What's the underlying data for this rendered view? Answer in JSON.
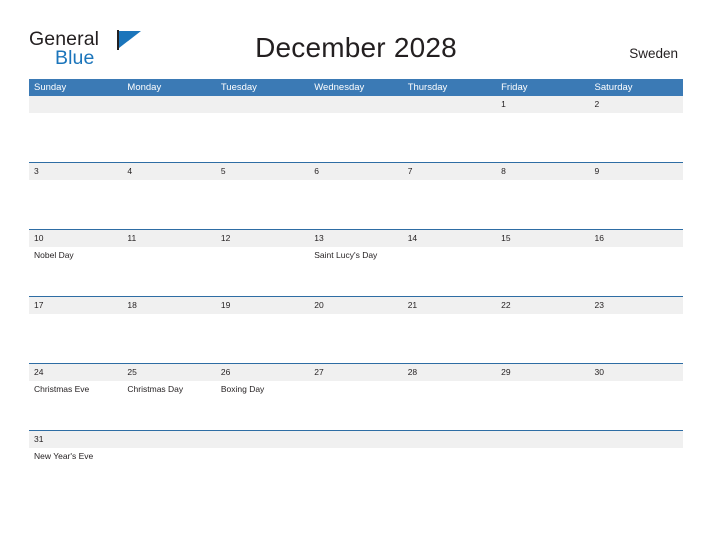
{
  "brand": {
    "name_part1": "General",
    "name_part2": "Blue",
    "flag_icon": "blue-flag-icon",
    "color_dark": "#231f20",
    "color_blue": "#1b75bb"
  },
  "header": {
    "title": "December 2028",
    "country": "Sweden"
  },
  "theme": {
    "header_blue": "#3b7ab5",
    "row_divider_blue": "#2e6da4",
    "date_band_gray": "#f0f0f0",
    "text_dark": "#231f20",
    "cell_white": "#ffffff"
  },
  "weekdays": [
    "Sunday",
    "Monday",
    "Tuesday",
    "Wednesday",
    "Thursday",
    "Friday",
    "Saturday"
  ],
  "weeks": [
    [
      {
        "date": "",
        "event": ""
      },
      {
        "date": "",
        "event": ""
      },
      {
        "date": "",
        "event": ""
      },
      {
        "date": "",
        "event": ""
      },
      {
        "date": "",
        "event": ""
      },
      {
        "date": "1",
        "event": ""
      },
      {
        "date": "2",
        "event": ""
      }
    ],
    [
      {
        "date": "3",
        "event": ""
      },
      {
        "date": "4",
        "event": ""
      },
      {
        "date": "5",
        "event": ""
      },
      {
        "date": "6",
        "event": ""
      },
      {
        "date": "7",
        "event": ""
      },
      {
        "date": "8",
        "event": ""
      },
      {
        "date": "9",
        "event": ""
      }
    ],
    [
      {
        "date": "10",
        "event": "Nobel Day"
      },
      {
        "date": "11",
        "event": ""
      },
      {
        "date": "12",
        "event": ""
      },
      {
        "date": "13",
        "event": "Saint Lucy's Day"
      },
      {
        "date": "14",
        "event": ""
      },
      {
        "date": "15",
        "event": ""
      },
      {
        "date": "16",
        "event": ""
      }
    ],
    [
      {
        "date": "17",
        "event": ""
      },
      {
        "date": "18",
        "event": ""
      },
      {
        "date": "19",
        "event": ""
      },
      {
        "date": "20",
        "event": ""
      },
      {
        "date": "21",
        "event": ""
      },
      {
        "date": "22",
        "event": ""
      },
      {
        "date": "23",
        "event": ""
      }
    ],
    [
      {
        "date": "24",
        "event": "Christmas Eve"
      },
      {
        "date": "25",
        "event": "Christmas Day"
      },
      {
        "date": "26",
        "event": "Boxing Day"
      },
      {
        "date": "27",
        "event": ""
      },
      {
        "date": "28",
        "event": ""
      },
      {
        "date": "29",
        "event": ""
      },
      {
        "date": "30",
        "event": ""
      }
    ],
    [
      {
        "date": "31",
        "event": "New Year's Eve"
      },
      {
        "date": "",
        "event": ""
      },
      {
        "date": "",
        "event": ""
      },
      {
        "date": "",
        "event": ""
      },
      {
        "date": "",
        "event": ""
      },
      {
        "date": "",
        "event": ""
      },
      {
        "date": "",
        "event": ""
      }
    ]
  ]
}
